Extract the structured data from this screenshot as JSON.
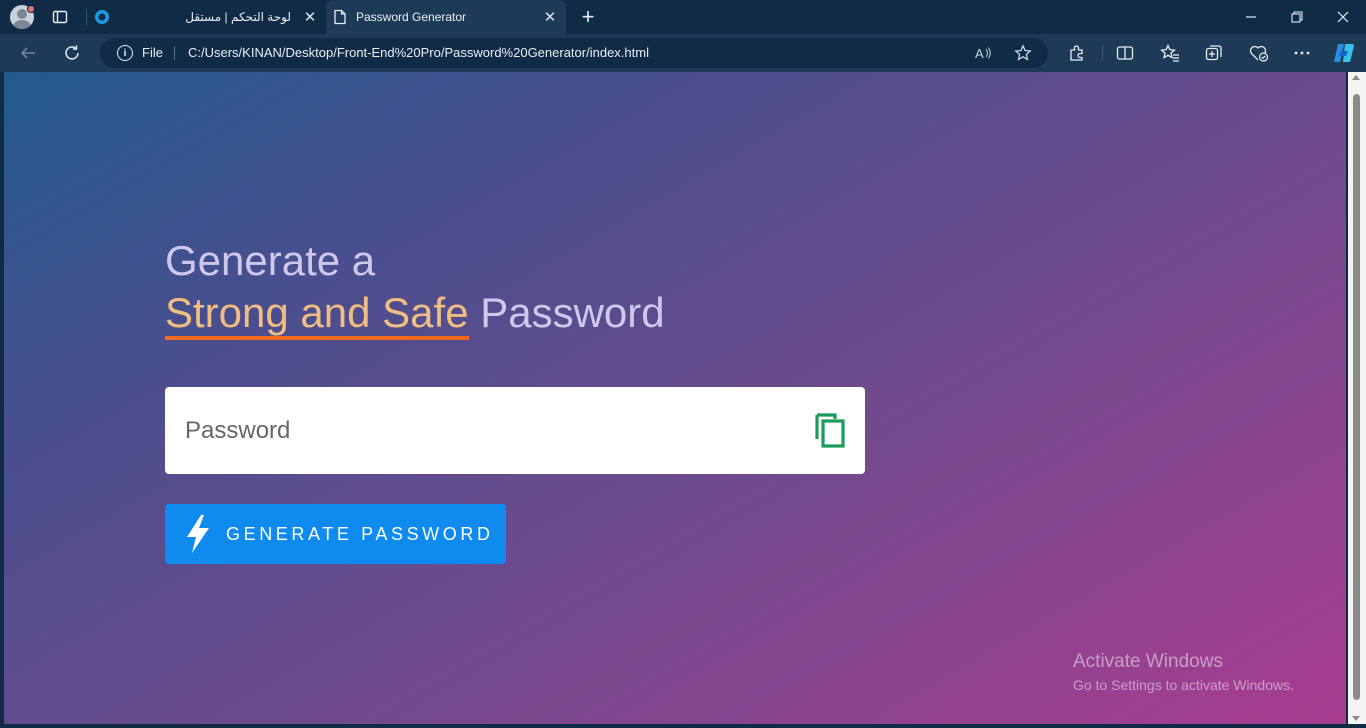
{
  "browser": {
    "tabs": [
      {
        "title": "لوحة التحكم | مستقل",
        "active": false
      },
      {
        "title": "Password Generator",
        "active": true
      }
    ],
    "address": {
      "scheme_label": "File",
      "url": "C:/Users/KINAN/Desktop/Front-End%20Pro/Password%20Generator/index.html"
    },
    "icons": {
      "close_glyph": "✕",
      "new_tab_glyph": "+",
      "minimize_glyph": "—",
      "maximize_glyph": "❐",
      "window_close_glyph": "✕"
    }
  },
  "page": {
    "heading_line1": "Generate a",
    "heading_accent": "Strong and Safe",
    "heading_rest": " Password",
    "password_placeholder": "Password",
    "password_value": "",
    "generate_label": "GENERATE PASSWORD",
    "colors": {
      "heading": "#cfc7ec",
      "accent": "#f0bd82",
      "underline": "#f26b1d",
      "button": "#0f8bf0",
      "copy_icon": "#1a9b5a"
    }
  },
  "watermark": {
    "title": "Activate Windows",
    "subtitle": "Go to Settings to activate Windows."
  }
}
